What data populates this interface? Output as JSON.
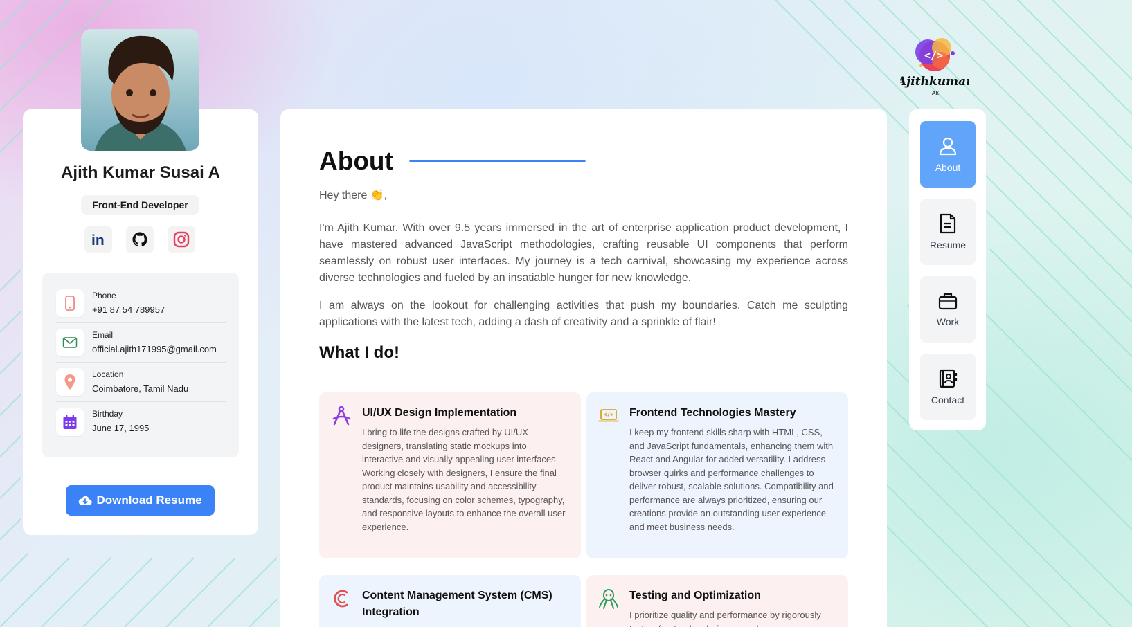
{
  "profile": {
    "name": "Ajith Kumar Susai A",
    "role": "Front-End Developer",
    "contacts": [
      {
        "label": "Phone",
        "value": "+91 87 54 789957",
        "icon": "phone-icon"
      },
      {
        "label": "Email",
        "value": "official.ajith171995@gmail.com",
        "icon": "mail-icon"
      },
      {
        "label": "Location",
        "value": "Coimbatore, Tamil Nadu",
        "icon": "location-pin-icon"
      },
      {
        "label": "Birthday",
        "value": "June 17, 1995",
        "icon": "calendar-icon"
      }
    ],
    "download_label": "Download Resume",
    "social": [
      "linkedin-icon",
      "github-icon",
      "instagram-icon"
    ]
  },
  "logo": {
    "main": "Ajithkumar",
    "sub": "Ak"
  },
  "about": {
    "title": "About",
    "greeting": "Hey there 👏,",
    "paragraphs": [
      "I'm Ajith Kumar. With over 9.5 years immersed in the art of enterprise application product development, I have mastered advanced JavaScript methodologies, crafting reusable UI components that perform seamlessly on robust user interfaces. My journey is a tech carnival, showcasing my experience across diverse technologies and fueled by an insatiable hunger for new knowledge.",
      "I am always on the lookout for challenging activities that push my boundaries. Catch me sculpting applications with the latest tech, adding a dash of creativity and a sprinkle of flair!"
    ],
    "what_i_do_title": "What I do!",
    "services": [
      {
        "title": "UI/UX Design Implementation",
        "icon": "design-compass-icon",
        "description": "I bring to life the designs crafted by UI/UX designers, translating static mockups into interactive and visually appealing user interfaces. Working closely with designers, I ensure the final product maintains usability and accessibility standards, focusing on color schemes, typography, and responsive layouts to enhance the overall user experience."
      },
      {
        "title": "Frontend Technologies Mastery",
        "icon": "code-laptop-icon",
        "description": "I keep my frontend skills sharp with HTML, CSS, and JavaScript fundamentals, enhancing them with React and Angular for added versatility. I address browser quirks and performance challenges to deliver robust, scalable solutions. Compatibility and performance are always prioritized, ensuring our creations provide an outstanding user experience and meet business needs."
      },
      {
        "title": "Content Management System (CMS) Integration",
        "icon": "cms-icon",
        "description": ""
      },
      {
        "title": "Testing and Optimization",
        "icon": "octopus-icon",
        "description": "I prioritize quality and performance by rigorously testing frontend code for cross-device"
      }
    ]
  },
  "nav": [
    {
      "label": "About",
      "icon": "user-icon",
      "active": true
    },
    {
      "label": "Resume",
      "icon": "document-icon",
      "active": false
    },
    {
      "label": "Work",
      "icon": "briefcase-icon",
      "active": false
    },
    {
      "label": "Contact",
      "icon": "contact-book-icon",
      "active": false
    }
  ],
  "colors": {
    "accent": "#3b82f6",
    "nav_active": "#60a5fa"
  }
}
